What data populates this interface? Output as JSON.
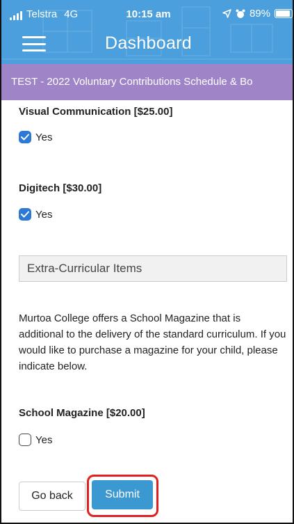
{
  "status_bar": {
    "carrier": "Telstra",
    "network": "4G",
    "time": "10:15 am",
    "battery": "89%",
    "battery_level": 0.89,
    "icons": [
      "signal-bars-icon",
      "location-arrow-icon",
      "alarm-clock-icon",
      "battery-icon"
    ]
  },
  "header": {
    "title": "Dashboard",
    "menu_icon": "hamburger-menu-icon"
  },
  "banner": {
    "text": "TEST - 2022 Voluntary Contributions Schedule & Bo"
  },
  "items": [
    {
      "label": "Visual Communication [$25.00]",
      "option": "Yes",
      "checked": true
    },
    {
      "label": "Digitech [$30.00]",
      "option": "Yes",
      "checked": true
    }
  ],
  "section": {
    "title": "Extra-Curricular Items",
    "description": "Murtoa College offers a School Magazine that is additional to the delivery of the standard curriculum. If you would like to purchase a magazine for your child, please indicate below."
  },
  "magazine": {
    "label": "School Magazine [$20.00]",
    "option": "Yes",
    "checked": false
  },
  "buttons": {
    "back": "Go back",
    "submit": "Submit"
  },
  "colors": {
    "header": "#4a9fdc",
    "banner": "#a084c8",
    "checkbox": "#2d7ad6",
    "submit": "#3c98d0",
    "highlight": "#e02020"
  }
}
